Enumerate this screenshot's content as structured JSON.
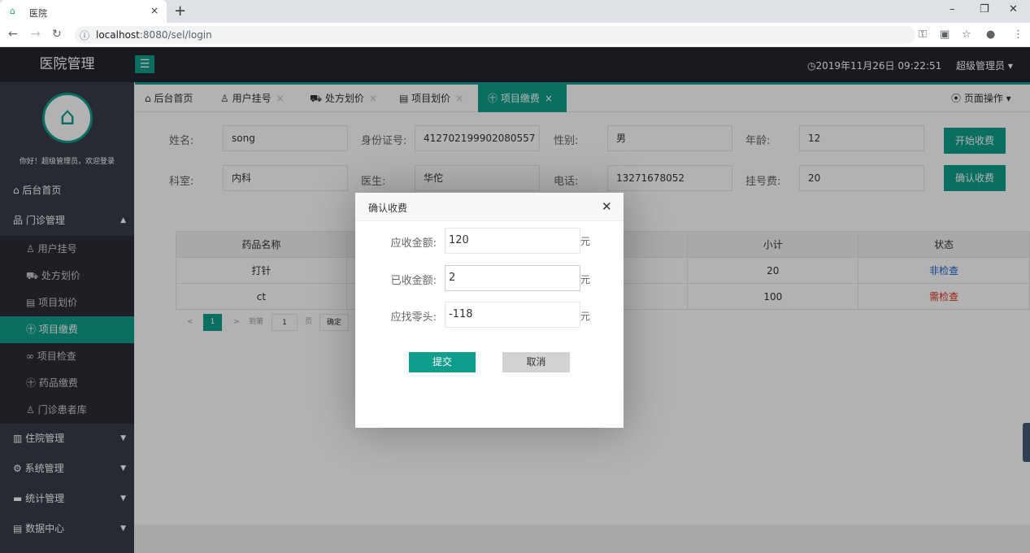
{
  "browser": {
    "tab_title": "医院",
    "url_host": "localhost",
    "url_path": ":8080/sel/login",
    "new_tab": "+",
    "tab_close": "×"
  },
  "header": {
    "app_title": "医院管理",
    "menu_toggle": "☰",
    "datetime": "◷2019年11月26日 09:22:51",
    "admin": "超级管理员 ▾"
  },
  "sidebar": {
    "welcome": "你好！超级管理员，欢迎登录",
    "home": "⌂ 后台首页",
    "groups": [
      {
        "label": "品 门诊管理",
        "arrow": "▲"
      },
      {
        "label": "▥ 住院管理",
        "arrow": "▼"
      },
      {
        "label": "⚙ 系统管理",
        "arrow": "▼"
      },
      {
        "label": "▬ 统计管理",
        "arrow": "▼"
      },
      {
        "label": "▤ 数据中心",
        "arrow": "▼"
      }
    ],
    "sub_items": [
      {
        "label": "♙ 用户挂号"
      },
      {
        "label": "⛟ 处方划价"
      },
      {
        "label": "▤ 项目划价"
      },
      {
        "label": "㊉ 项目缴费"
      },
      {
        "label": "∞ 项目检查"
      },
      {
        "label": "㊉ 药品缴费"
      },
      {
        "label": "♙ 门诊患者库"
      }
    ]
  },
  "tabs": [
    {
      "label": "⌂ 后台首页",
      "close": ""
    },
    {
      "label": "♙ 用户挂号",
      "close": "×"
    },
    {
      "label": "⛟ 处方划价",
      "close": "×"
    },
    {
      "label": "▤ 项目划价",
      "close": "×"
    },
    {
      "label": "㊉ 项目缴费",
      "close": "×"
    }
  ],
  "page_ops": "⦿ 页面操作 ▾",
  "form": {
    "name_label": "姓名:",
    "name_value": "song",
    "id_label": "身份证号:",
    "id_value": "412702199902080557",
    "gender_label": "性别:",
    "gender_value": "男",
    "age_label": "年龄:",
    "age_value": "12",
    "dept_label": "科室:",
    "dept_value": "内科",
    "doctor_label": "医生:",
    "doctor_value": "华佗",
    "phone_label": "电话:",
    "phone_value": "13271678052",
    "fee_label": "挂号费:",
    "fee_value": "20",
    "start_button": "开始收费",
    "confirm_button": "确认收费"
  },
  "table": {
    "col_name": "药品名称",
    "col_subtotal": "小计",
    "col_status": "状态",
    "rows": [
      {
        "name": "打针",
        "subtotal": "20",
        "status": "非检查",
        "status_color": "#1e5fd0"
      },
      {
        "name": "ct",
        "subtotal": "100",
        "status": "需检查",
        "status_color": "#e0301e"
      }
    ]
  },
  "pager": {
    "prev": "<",
    "current": "1",
    "next": ">",
    "goto": "到第",
    "page_input": "1",
    "page_unit": "页",
    "confirm": "确定"
  },
  "dialog": {
    "title": "确认收费",
    "close": "✕",
    "due_label": "应收金额:",
    "due_value": "120",
    "paid_label": "已收金额:",
    "paid_value": "2",
    "change_label": "应找零头:",
    "change_value": "-118",
    "unit": "元",
    "submit": "提交",
    "cancel": "取消"
  },
  "colors": {
    "accent": "#0f9e8c",
    "header_bg": "#23262e",
    "sidebar_bg": "#393d49"
  }
}
